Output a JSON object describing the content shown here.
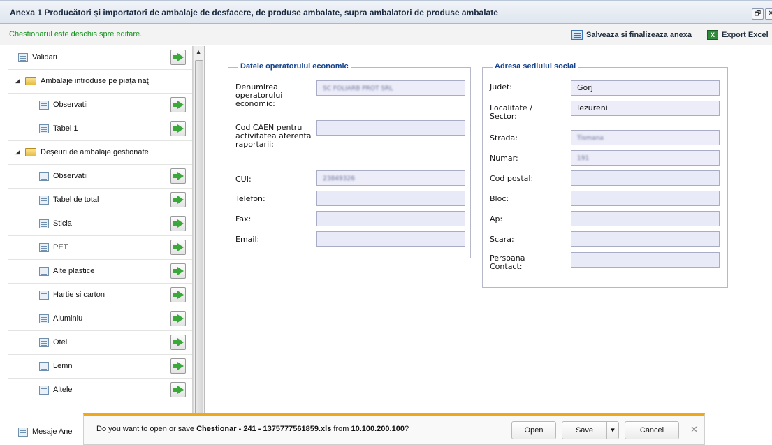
{
  "window": {
    "title": "Anexa 1 Producători şi importatori de ambalaje de desfacere, de produse ambalate, supra ambalatori de produse ambalate",
    "restore_glyph": "🗗",
    "close_glyph": "✕"
  },
  "toolbar": {
    "status": "Chestionarul este deschis spre editare.",
    "save_label": "Salveaza si finalizeaza anexa",
    "export_label": "Export Excel",
    "xls_glyph": "X"
  },
  "sidebar": {
    "items": [
      {
        "label": "Validari",
        "kind": "form",
        "level": 0
      },
      {
        "label": "Ambalaje introduse pe piaţa naţ",
        "kind": "folder",
        "level": 0
      },
      {
        "label": "Observatii",
        "kind": "form",
        "level": 1
      },
      {
        "label": "Tabel 1",
        "kind": "form",
        "level": 1
      },
      {
        "label": "Deşeuri de ambalaje gestionate",
        "kind": "folder",
        "level": 0
      },
      {
        "label": "Observatii",
        "kind": "form",
        "level": 1
      },
      {
        "label": "Tabel de total",
        "kind": "form",
        "level": 1
      },
      {
        "label": "Sticla",
        "kind": "form",
        "level": 1
      },
      {
        "label": "PET",
        "kind": "form",
        "level": 1
      },
      {
        "label": "Alte plastice",
        "kind": "form",
        "level": 1
      },
      {
        "label": "Hartie si carton",
        "kind": "form",
        "level": 1
      },
      {
        "label": "Aluminiu",
        "kind": "form",
        "level": 1
      },
      {
        "label": "Otel",
        "kind": "form",
        "level": 1
      },
      {
        "label": "Lemn",
        "kind": "form",
        "level": 1
      },
      {
        "label": "Altele",
        "kind": "form",
        "level": 1
      },
      {
        "label": "Mesaje Ane",
        "kind": "form",
        "level": 0
      }
    ],
    "expand_glyph": "◢",
    "scroll_up_glyph": "▲"
  },
  "operator": {
    "legend": "Datele operatorului economic",
    "denumire_label": "Denumirea operatorului economic:",
    "denumire_value": "SC FOLIARB PROT SRL",
    "caen_label": "Cod CAEN pentru activitatea aferenta raportarii:",
    "caen_value": "",
    "cui_label": "CUI:",
    "cui_value": "23849326",
    "telefon_label": "Telefon:",
    "telefon_value": "",
    "fax_label": "Fax:",
    "fax_value": "",
    "email_label": "Email:",
    "email_value": ""
  },
  "address": {
    "legend": "Adresa sediului social",
    "judet_label": "Judet:",
    "judet_value": "Gorj",
    "localitate_label": "Localitate / Sector:",
    "localitate_value": "Iezureni",
    "strada_label": "Strada:",
    "strada_value": "Tismana",
    "numar_label": "Numar:",
    "numar_value": "191",
    "cod_postal_label": "Cod postal:",
    "cod_postal_value": "",
    "bloc_label": "Bloc:",
    "bloc_value": "",
    "ap_label": "Ap:",
    "ap_value": "",
    "scara_label": "Scara:",
    "scara_value": "",
    "persoana_label": "Persoana Contact:",
    "persoana_value": ""
  },
  "download": {
    "prefix": "Do you want to open or save ",
    "filename": "Chestionar - 241 - 1375777561859.xls",
    "middle": " from ",
    "host": "10.100.200.100",
    "suffix": "?",
    "open_label": "Open",
    "save_label": "Save",
    "dropdown_glyph": "▾",
    "cancel_label": "Cancel",
    "close_glyph": "✕"
  }
}
